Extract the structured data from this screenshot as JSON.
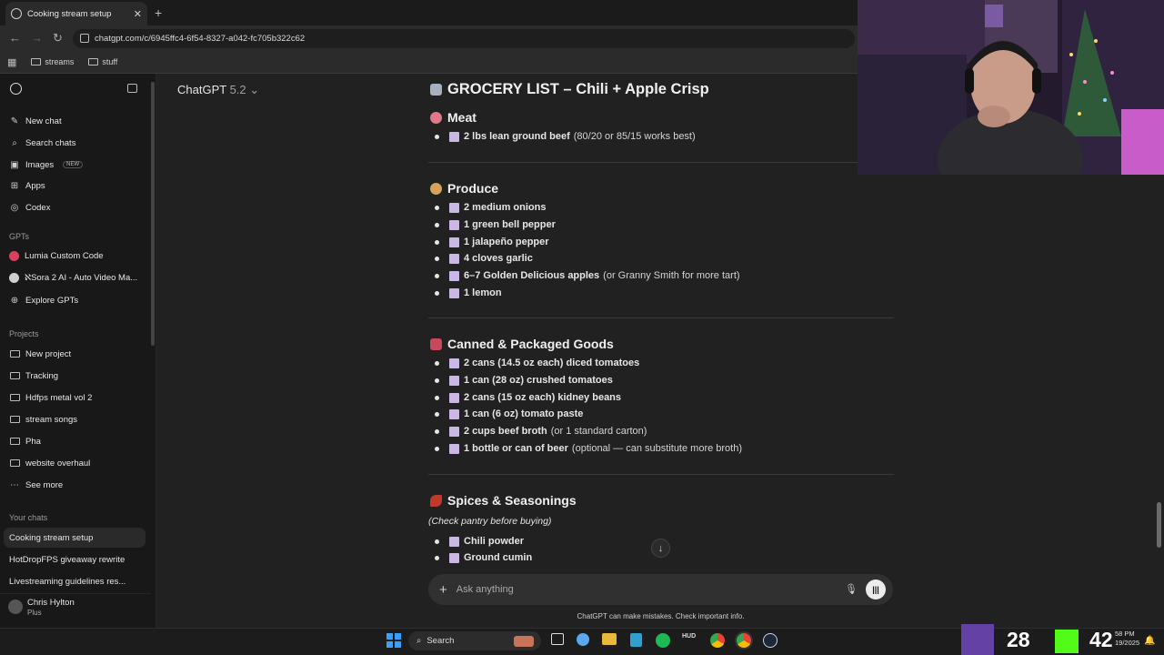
{
  "browser": {
    "tab_title": "Cooking stream setup",
    "url": "chatgpt.com/c/6945ffc4-6f54-8327-a042-fc705b322c62",
    "bookmarks": [
      "streams",
      "stuff"
    ]
  },
  "sidebar": {
    "top_items": [
      {
        "label": "New chat",
        "icon": "edit-icon"
      },
      {
        "label": "Search chats",
        "icon": "search-icon"
      },
      {
        "label": "Images",
        "icon": "image-icon",
        "badge": "NEW"
      },
      {
        "label": "Apps",
        "icon": "apps-icon"
      },
      {
        "label": "Codex",
        "icon": "codex-icon"
      }
    ],
    "gpts_heading": "GPTs",
    "gpts": [
      {
        "label": "Lumia Custom Code"
      },
      {
        "label": "ℵSora 2 AI - Auto Video Ma..."
      },
      {
        "label": "Explore GPTs"
      }
    ],
    "projects_heading": "Projects",
    "projects": [
      "New project",
      "Tracking",
      "Hdfps metal vol 2",
      "stream songs",
      "Pha",
      "website overhaul",
      "See more"
    ],
    "chats_heading": "Your chats",
    "chats": [
      "Cooking stream setup",
      "HotDropFPS giveaway rewrite",
      "Livestreaming guidelines res..."
    ],
    "user": {
      "name": "Chris Hylton",
      "plan": "Plus"
    }
  },
  "model": {
    "name": "ChatGPT",
    "version": "5.2"
  },
  "content": {
    "title": "GROCERY LIST – Chili + Apple Crisp",
    "sections": [
      {
        "heading": "Meat",
        "items": [
          {
            "bold": "2 lbs lean ground beef",
            "rest": "(80/20 or 85/15 works best)"
          }
        ]
      },
      {
        "heading": "Produce",
        "items": [
          {
            "bold": "2 medium onions",
            "rest": ""
          },
          {
            "bold": "1 green bell pepper",
            "rest": ""
          },
          {
            "bold": "1 jalapeño pepper",
            "rest": ""
          },
          {
            "bold": "4 cloves garlic",
            "rest": ""
          },
          {
            "bold": "6–7 Golden Delicious apples",
            "rest": "(or Granny Smith for more tart)"
          },
          {
            "bold": "1 lemon",
            "rest": ""
          }
        ]
      },
      {
        "heading": "Canned & Packaged Goods",
        "items": [
          {
            "bold": "2 cans (14.5 oz each) diced tomatoes",
            "rest": ""
          },
          {
            "bold": "1 can (28 oz) crushed tomatoes",
            "rest": ""
          },
          {
            "bold": "2 cans (15 oz each) kidney beans",
            "rest": ""
          },
          {
            "bold": "1 can (6 oz) tomato paste",
            "rest": ""
          },
          {
            "bold": "2 cups beef broth",
            "rest": "(or 1 standard carton)"
          },
          {
            "bold": "1 bottle or can of beer",
            "rest": "(optional — can substitute more broth)"
          }
        ]
      },
      {
        "heading": "Spices & Seasonings",
        "note": "(Check pantry before buying)",
        "items": [
          {
            "bold": "Chili powder",
            "rest": ""
          },
          {
            "bold": "Ground cumin",
            "rest": ""
          }
        ]
      }
    ]
  },
  "composer": {
    "placeholder": "Ask anything"
  },
  "disclaimer": "ChatGPT can make mistakes. Check important info.",
  "taskbar": {
    "search_label": "Search",
    "overlay_counter_1": "28",
    "overlay_counter_2": "42",
    "clock_time": "58 PM",
    "clock_date": "19/2025"
  },
  "colors": {
    "background": "#212121",
    "sidebar": "#181818",
    "checkbox": "#cbb7e3"
  }
}
